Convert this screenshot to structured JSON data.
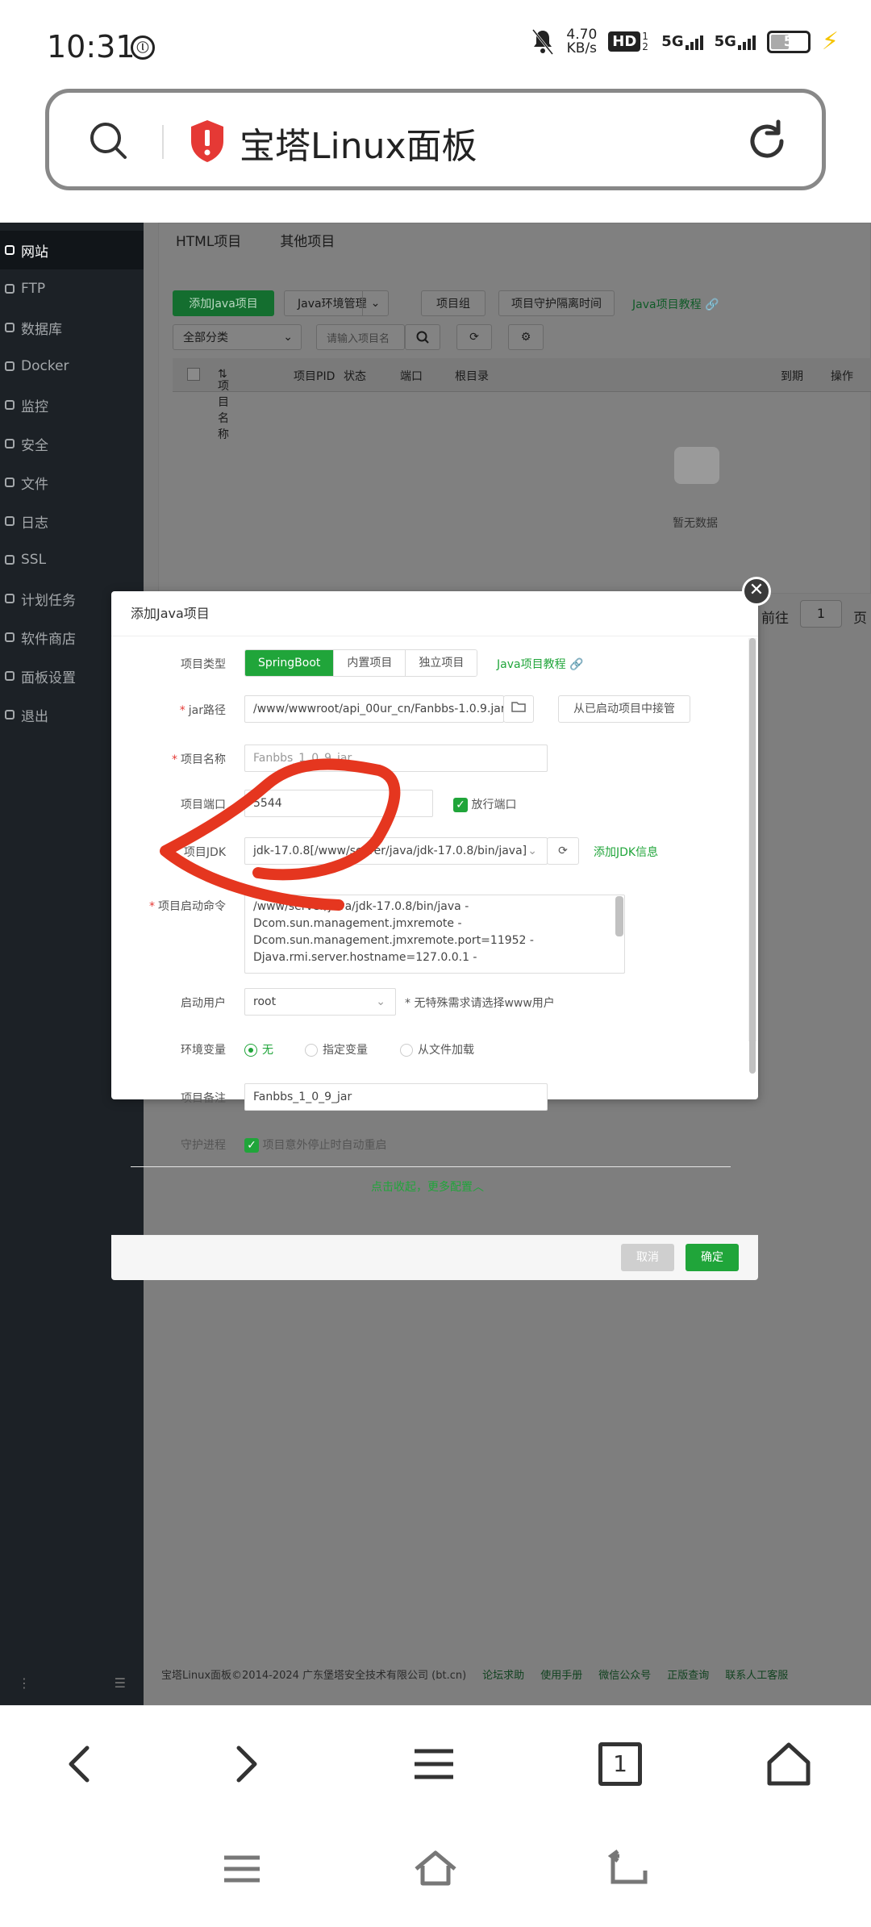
{
  "status_bar": {
    "time": "10:31",
    "net_speed_value": "4.70",
    "net_speed_unit": "KB/s",
    "hd_label": "HD",
    "hd_sub": "1 2",
    "sim1_label": "5G",
    "sim2_label": "5G",
    "battery_level": "5",
    "battery_fraction": 0.5
  },
  "address_bar": {
    "title": "宝塔Linux面板"
  },
  "sidebar": {
    "items": [
      {
        "label": "网站",
        "active": true
      },
      {
        "label": "FTP"
      },
      {
        "label": "数据库"
      },
      {
        "label": "Docker"
      },
      {
        "label": "监控"
      },
      {
        "label": "安全"
      },
      {
        "label": "文件"
      },
      {
        "label": "日志"
      },
      {
        "label": "SSL"
      },
      {
        "label": "计划任务"
      },
      {
        "label": "软件商店"
      },
      {
        "label": "面板设置"
      },
      {
        "label": "退出"
      }
    ]
  },
  "project_tabs": {
    "html": "HTML项目",
    "other": "其他项目"
  },
  "toolbar": {
    "add_java": "添加Java项目",
    "java_env": "Java环境管理",
    "project_group": "项目组",
    "guard_interval": "项目守护隔离时间",
    "java_tutorial": "Java项目教程",
    "category": "全部分类",
    "search_placeholder": "请输入项目名"
  },
  "table": {
    "headers": [
      "项目名称",
      "项目PID",
      "状态",
      "端口",
      "根目录",
      "到期",
      "操作"
    ],
    "empty": "暂无数据"
  },
  "pager": {
    "goto": "前往",
    "page": "1",
    "unit": "页"
  },
  "footer": {
    "copyright": "宝塔Linux面板©2014-2024 广东堡塔安全技术有限公司 (bt.cn)",
    "links": [
      "论坛求助",
      "使用手册",
      "微信公众号",
      "正版查询",
      "联系人工客服"
    ]
  },
  "dialog": {
    "title": "添加Java项目",
    "project_type_label": "项目类型",
    "project_types": [
      "SpringBoot",
      "内置项目",
      "独立项目"
    ],
    "tutorial_link": "Java项目教程",
    "jar_path_label": "jar路径",
    "jar_path_value": "/www/wwwroot/api_00ur_cn/Fanbbs-1.0.9.jar",
    "take_over_button": "从已启动项目中接管",
    "project_name_label": "项目名称",
    "project_name_value": "Fanbbs_1_0_9_jar",
    "project_port_label": "项目端口",
    "project_port_value": "5544",
    "open_port_label": "放行端口",
    "jdk_label": "项目JDK",
    "jdk_value": "jdk-17.0.8[/www/server/java/jdk-17.0.8/bin/java]",
    "add_jdk_link": "添加JDK信息",
    "cmd_label": "项目启动命令",
    "cmd_lines": [
      "/www/server/java/jdk-17.0.8/bin/java -",
      "Dcom.sun.management.jmxremote -",
      "Dcom.sun.management.jmxremote.port=11952 -",
      "Djava.rmi.server.hostname=127.0.0.1 -"
    ],
    "user_label": "启动用户",
    "user_value": "root",
    "user_hint": "* 无特殊需求请选择www用户",
    "env_label": "环境变量",
    "env_options": [
      "无",
      "指定变量",
      "从文件加载"
    ],
    "remark_label": "项目备注",
    "remark_value": "Fanbbs_1_0_9_jar",
    "guard_label": "守护进程",
    "guard_option": "项目意外停止时自动重启",
    "collapse_link": "点击收起，更多配置",
    "cancel_button": "取消",
    "ok_button": "确定"
  },
  "browser_toolbar": {
    "tab_count": "1"
  },
  "colors": {
    "accent_green": "#20a53a",
    "sidebar_bg": "#1c2126",
    "annotation_red": "#e5361f"
  }
}
